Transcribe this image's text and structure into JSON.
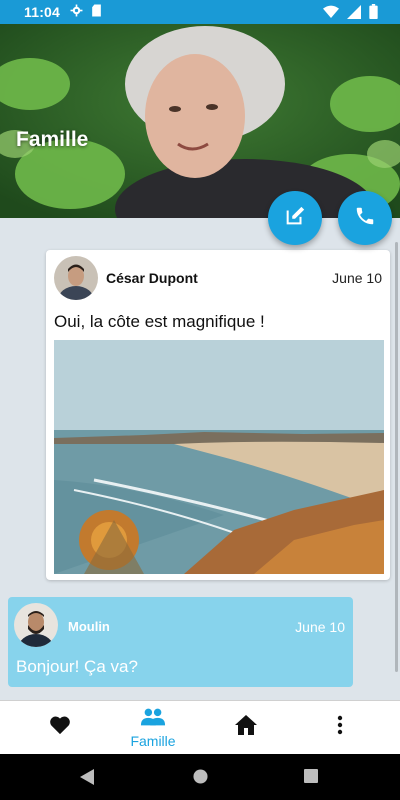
{
  "status_bar": {
    "time": "11:04",
    "icons": [
      "settings-icon",
      "sd-card-icon",
      "wifi-icon",
      "signal-icon",
      "battery-icon"
    ]
  },
  "header": {
    "title": "Famille"
  },
  "actions": {
    "icons": [
      "edit-icon",
      "phone-icon"
    ],
    "accent": "#1aa3df"
  },
  "posts": [
    {
      "author": "César Dupont",
      "date": "June 10",
      "text": "Oui, la côte est magnifique !"
    },
    {
      "author": "Moulin",
      "date": "June 10",
      "text": "Bonjour! Ça va?",
      "background": "#87d3ec"
    }
  ],
  "bottom_nav": {
    "items": [
      {
        "icon": "heart-icon",
        "label": ""
      },
      {
        "icon": "people-icon",
        "label": "Famille",
        "active": true
      },
      {
        "icon": "home-icon",
        "label": ""
      },
      {
        "icon": "more-vertical-icon",
        "label": ""
      }
    ]
  },
  "system_nav": {
    "icons": [
      "back-icon",
      "home-circle-icon",
      "recents-icon"
    ]
  },
  "colors": {
    "status_bar": "#1a9ad6",
    "feed_background": "#dde4ea"
  }
}
